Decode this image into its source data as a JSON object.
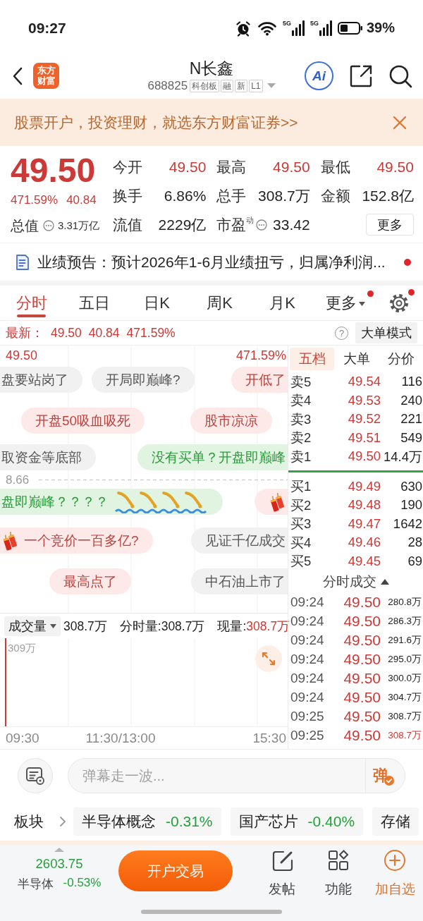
{
  "status_bar": {
    "time": "09:27",
    "signal_labels": [
      "5G",
      "5G"
    ],
    "battery": "39%"
  },
  "header": {
    "logo_lines": [
      "东方",
      "财富"
    ],
    "title": "N长鑫",
    "code": "688825",
    "tags": [
      "科创板",
      "融",
      "新",
      "L1"
    ],
    "ai_label": "Ai"
  },
  "banner": {
    "text": "股票开户，投资理财，就选东方财富证券>>"
  },
  "quote": {
    "price": "49.50",
    "change_percent": "471.59%",
    "change": "40.84",
    "up": true,
    "total_value": {
      "label": "总值",
      "value": "3.31万亿",
      "info": true
    },
    "stats": [
      {
        "label": "今开",
        "value": "49.50",
        "up": true,
        "info": false
      },
      {
        "label": "最高",
        "value": "49.50",
        "up": true,
        "info": false
      },
      {
        "label": "最低",
        "value": "49.50",
        "up": true,
        "info": false
      },
      {
        "label": "换手",
        "value": "6.86%",
        "up": false,
        "info": false
      },
      {
        "label": "总手",
        "value": "308.7万",
        "up": false,
        "info": false
      },
      {
        "label": "金额",
        "value": "152.8亿",
        "up": false,
        "info": false
      },
      {
        "label": "流值",
        "value": "2229亿",
        "up": false,
        "info": false
      },
      {
        "label": "市盈$^{动}$",
        "value": "33.42",
        "up": false,
        "info": true
      }
    ],
    "more_button": "更多"
  },
  "notice": {
    "text": "业绩预告：预计2026年1-6月业绩扭亏，归属净利润...",
    "unread": true
  },
  "tabs": [
    {
      "label": "分时",
      "selected": true,
      "dropdown": false,
      "badge": false
    },
    {
      "label": "五日",
      "selected": false,
      "dropdown": false,
      "badge": false
    },
    {
      "label": "日K",
      "selected": false,
      "dropdown": false,
      "badge": false
    },
    {
      "label": "周K",
      "selected": false,
      "dropdown": false,
      "badge": false
    },
    {
      "label": "月K",
      "selected": false,
      "dropdown": false,
      "badge": false
    },
    {
      "label": "更多",
      "selected": false,
      "dropdown": true,
      "badge": true
    }
  ],
  "settings": {
    "badge": true
  },
  "latest": {
    "label": "最新：",
    "price": "49.50",
    "change": "40.84",
    "percent": "471.59%",
    "up": true
  },
  "help": "?",
  "mode_button": "大单模式",
  "chart": {
    "price_label": "49.50",
    "percent_label": "471.59%",
    "baseline_label": "8.66",
    "up": true,
    "danmaku": [
      {
        "text": "盘要站岗了",
        "kind": "gray"
      },
      {
        "text": "开局即巅峰?",
        "kind": "gray"
      },
      {
        "text": "开低了",
        "kind": "pink"
      },
      {
        "text": "开盘50吸血吸死",
        "kind": "pink"
      },
      {
        "text": "股市凉凉",
        "kind": "pink"
      },
      {
        "text": "取资金等底部",
        "kind": "gray"
      },
      {
        "text": "没有买单？开盘即巅峰",
        "kind": "green"
      },
      {
        "text": "盘即巅峰？？？？",
        "kind": "divers"
      },
      {
        "kind": "firecracker"
      },
      {
        "text": "一个竞价一百多亿?",
        "kind": "firecracker"
      },
      {
        "text": "见证千亿成交",
        "kind": "gray"
      },
      {
        "text": "最高点了",
        "kind": "pink"
      },
      {
        "text": "中石油上市了",
        "kind": "gray"
      }
    ]
  },
  "volume": {
    "selector": "成交量",
    "total": "308.7万",
    "period": "分时量:308.7万",
    "current_label": "现量:",
    "current": "308.7万",
    "current_up": true,
    "max_label": "309万"
  },
  "time_axis": [
    "09:30",
    "11:30/13:00",
    "15:30"
  ],
  "order_book": {
    "tabs": [
      {
        "label": "五档",
        "selected": true
      },
      {
        "label": "大单",
        "selected": false
      },
      {
        "label": "分价",
        "selected": false
      }
    ],
    "asks": [
      {
        "label": "卖5",
        "price": "49.54",
        "volume": "116",
        "up": true
      },
      {
        "label": "卖4",
        "price": "49.53",
        "volume": "240",
        "up": true
      },
      {
        "label": "卖3",
        "price": "49.52",
        "volume": "221",
        "up": true
      },
      {
        "label": "卖2",
        "price": "49.51",
        "volume": "549",
        "up": true
      },
      {
        "label": "卖1",
        "price": "49.50",
        "volume": "14.4万",
        "up": true
      }
    ],
    "bids": [
      {
        "label": "买1",
        "price": "49.49",
        "volume": "630",
        "up": true
      },
      {
        "label": "买2",
        "price": "49.48",
        "volume": "190",
        "up": true
      },
      {
        "label": "买3",
        "price": "49.47",
        "volume": "1642",
        "up": true
      },
      {
        "label": "买4",
        "price": "49.46",
        "volume": "28",
        "up": true
      },
      {
        "label": "买5",
        "price": "49.45",
        "volume": "69",
        "up": true
      }
    ],
    "trades_title": "分时成交",
    "trades": [
      {
        "time": "09:24",
        "price": "49.50",
        "volume": "280.8万",
        "up": true,
        "volume_up": false
      },
      {
        "time": "09:24",
        "price": "49.50",
        "volume": "286.3万",
        "up": true,
        "volume_up": false
      },
      {
        "time": "09:24",
        "price": "49.50",
        "volume": "291.6万",
        "up": true,
        "volume_up": false
      },
      {
        "time": "09:24",
        "price": "49.50",
        "volume": "295.0万",
        "up": true,
        "volume_up": false
      },
      {
        "time": "09:24",
        "price": "49.50",
        "volume": "300.0万",
        "up": true,
        "volume_up": false
      },
      {
        "time": "09:24",
        "price": "49.50",
        "volume": "304.7万",
        "up": true,
        "volume_up": false
      },
      {
        "time": "09:25",
        "price": "49.50",
        "volume": "308.7万",
        "up": true,
        "volume_up": false
      },
      {
        "time": "09:25",
        "price": "49.50",
        "volume": "308.7万",
        "up": true,
        "volume_up": true
      }
    ]
  },
  "comment_bar": {
    "placeholder": "弹幕走一波...",
    "toggle_label": "弹",
    "toggle_on": true
  },
  "sectors": {
    "label": "板块",
    "items": [
      {
        "name": "半导体概念",
        "change": "-0.31%",
        "down": true
      },
      {
        "name": "国产芯片",
        "change": "-0.40%",
        "down": true
      },
      {
        "name": "存储"
      }
    ]
  },
  "bottom_bar": {
    "index_value": "2603.75",
    "index_name": "半导体",
    "index_change": "-0.53%",
    "down": true,
    "trade_button": "开户交易",
    "actions": [
      {
        "label": "发帖",
        "kind": "post",
        "highlight": false
      },
      {
        "label": "功能",
        "kind": "apps",
        "highlight": false
      },
      {
        "label": "加自选",
        "kind": "add",
        "highlight": true
      }
    ]
  }
}
